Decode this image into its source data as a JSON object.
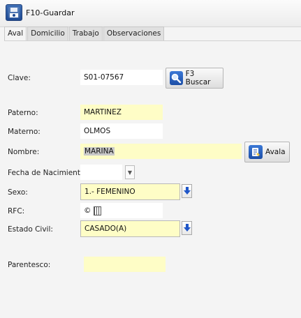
{
  "toolbar": {
    "save_label": "F10-Guardar"
  },
  "tabs": [
    {
      "label": "Aval",
      "active": true
    },
    {
      "label": "Domicilio",
      "active": false
    },
    {
      "label": "Trabajo",
      "active": false
    },
    {
      "label": "Observaciones",
      "active": false
    }
  ],
  "form": {
    "clave": {
      "label": "Clave:",
      "value": "S01-07567"
    },
    "buscar_button": {
      "label": "F3 Buscar",
      "icon": "magnifier-icon"
    },
    "paterno": {
      "label": "Paterno:",
      "value": "MARTINEZ"
    },
    "materno": {
      "label": "Materno:",
      "value": "OLMOS"
    },
    "nombre": {
      "label": "Nombre:",
      "value": "MARINA"
    },
    "avala_button": {
      "label": "Avala",
      "icon": "document-icon"
    },
    "fecha_nacimiento": {
      "label": "Fecha de Nacimiento:",
      "value": ""
    },
    "sexo": {
      "label": "Sexo:",
      "value": "1.- FEMENINO"
    },
    "rfc": {
      "label": "RFC:",
      "value": "©"
    },
    "estado_civil": {
      "label": "Estado Civil:",
      "value": "CASADO(A)"
    },
    "parentesco": {
      "label": "Parentesco:",
      "value": ""
    }
  },
  "colors": {
    "required_field": "#fefdc6",
    "accent_blue": "#1f56c8"
  }
}
